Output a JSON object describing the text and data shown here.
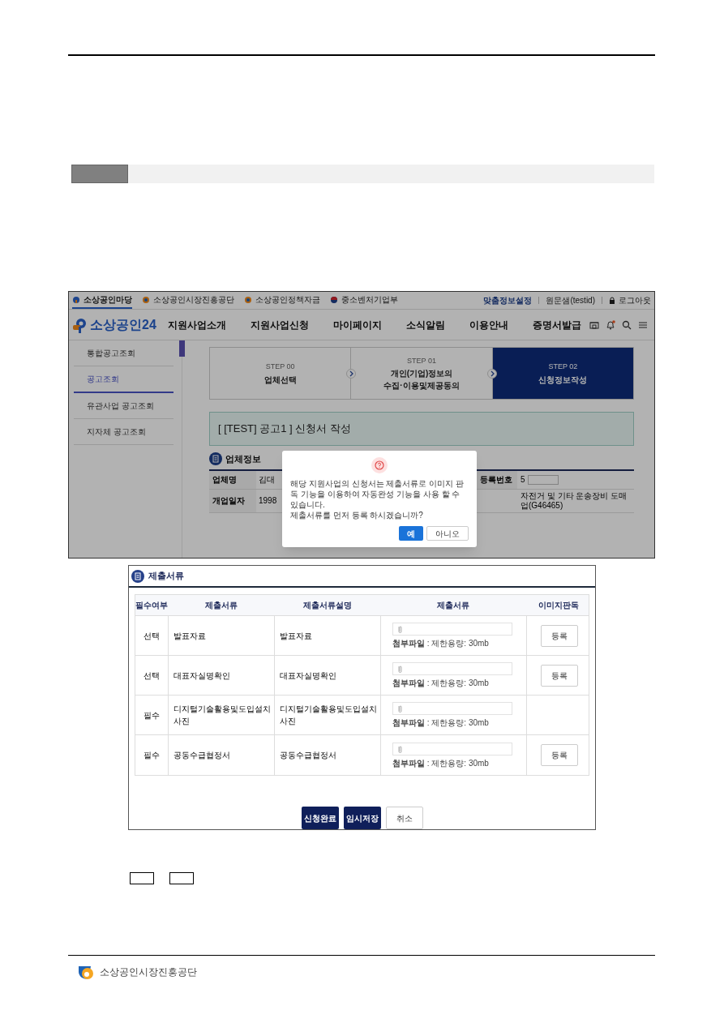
{
  "screenshot_1": {
    "top_links": [
      {
        "label": "소상공인마당",
        "kind": "p-logo",
        "selected": true
      },
      {
        "label": "소상공인시장진흥공단",
        "kind": "ring-logo",
        "selected": false
      },
      {
        "label": "소상공인정책자금",
        "kind": "ring-logo",
        "selected": false
      },
      {
        "label": "중소벤처기업부",
        "kind": "circle-logo",
        "selected": false
      }
    ],
    "user_links": [
      {
        "label": "맞춤정보설정",
        "kind": "highlight"
      },
      {
        "label": "원문샘(testid)",
        "kind": "plain"
      },
      {
        "label": "로그아웃",
        "kind": "lock"
      }
    ],
    "logo": "소상공인24",
    "nav": [
      "지원사업소개",
      "지원사업신청",
      "마이페이지",
      "소식알림",
      "이용안내",
      "증명서발급"
    ],
    "sidebar": [
      {
        "label": "통합공고조회",
        "selected": false
      },
      {
        "label": "공고조회",
        "selected": true
      },
      {
        "label": "유관사업 공고조회",
        "selected": false
      },
      {
        "label": "지자체 공고조회",
        "selected": false
      }
    ],
    "steps": [
      {
        "step": "STEP 00",
        "title_lines": [
          "업체선택"
        ],
        "selected": false
      },
      {
        "step": "STEP 01",
        "title_lines": [
          "개인(기업)정보의",
          "수집·이용및제공동의"
        ],
        "selected": false
      },
      {
        "step": "STEP 02",
        "title_lines": [
          "신청정보작성"
        ],
        "selected": true
      }
    ],
    "page_title": "[ [TEST] 공고1 ] 신청서 작성",
    "section_title": "업체정보",
    "info_rows": [
      {
        "label": "업체명",
        "value": "김대",
        "label_2": "등록번호",
        "value_2": "5",
        "masked": true
      },
      {
        "label": "개업일자",
        "value": "1998",
        "value_2": "자전거 및 기타 운송장비 도매업(G46465)",
        "masked": false
      }
    ],
    "dialog": {
      "paragraphs": [
        "해당 지원사업의 신청서는 제출서류로 이미지 판독 기능을 이용하여 자동완성 기능을 사용 할 수 있습니다.",
        "제출서류를 먼저 등록 하시겠습니까?"
      ],
      "buttons": [
        {
          "label": "예",
          "primary": true
        },
        {
          "label": "아니오",
          "primary": false
        }
      ]
    }
  },
  "screenshot_2": {
    "section_title": "제출서류",
    "columns": [
      "필수여부",
      "제출서류",
      "제출서류설명",
      "제출서류",
      "이미지판독"
    ],
    "rows": [
      {
        "required": "선택",
        "document": "발표자료",
        "description": "발표자료",
        "file_note": "**첨부파일** : 제한용량: 30mb",
        "register": "등록"
      },
      {
        "required": "선택",
        "document": "대표자실명확인",
        "description": "대표자실명확인",
        "file_note": "**첨부파일** : 제한용량: 30mb",
        "register": "등록"
      },
      {
        "required": "필수",
        "document": "디지털기술활용및도입설치사진",
        "description": "디지털기술활용및도입설치사진",
        "file_note": "**첨부파일** : 제한용량: 30mb"
      },
      {
        "required": "필수",
        "document": "공동수급협정서",
        "description": "공동수급협정서",
        "file_note": "**첨부파일** : 제한용량: 30mb",
        "register": "등록"
      }
    ],
    "buttons": [
      {
        "label": "신청완료",
        "kind": "primary"
      },
      {
        "label": "임시저장",
        "kind": "primary"
      },
      {
        "label": "취소",
        "kind": "secondary"
      }
    ]
  },
  "footer": {
    "organization": "소상공인시장진흥공단"
  }
}
